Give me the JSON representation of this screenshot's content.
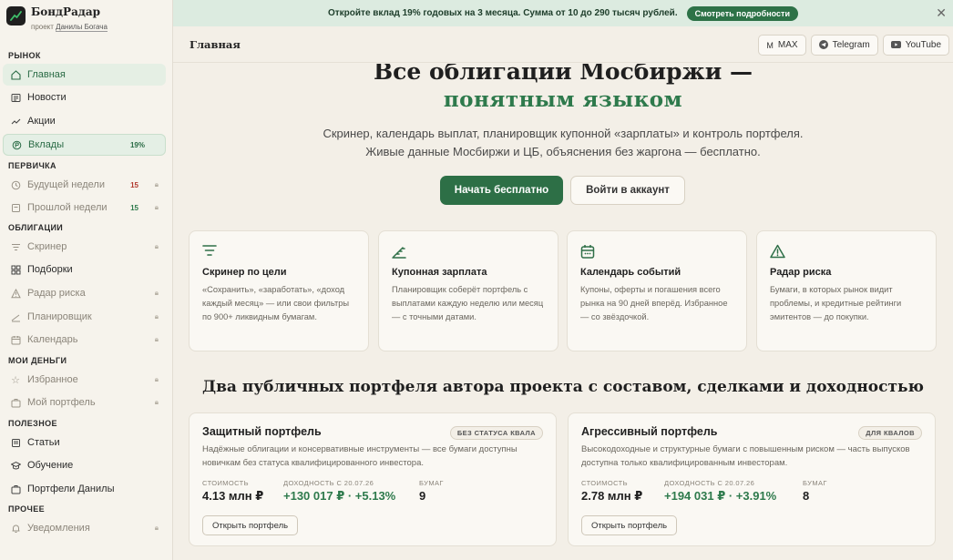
{
  "sidebar": {
    "brand_name": "БондРадар",
    "brand_sub_prefix": "проект",
    "brand_sub_author": "Данилы Богача",
    "sections": {
      "market": "РЫНОК",
      "primary": "ПЕРВИЧКА",
      "bonds": "ОБЛИГАЦИИ",
      "my_money": "МОИ ДЕНЬГИ",
      "useful": "ПОЛЕЗНОЕ",
      "other": "ПРОЧЕЕ"
    },
    "items": {
      "home": "Главная",
      "news": "Новости",
      "stocks": "Акции",
      "deposits": "Вклады",
      "deposits_badge": "19%",
      "next_week": "Будущей недели",
      "next_week_count": "15",
      "past_week": "Прошлой недели",
      "past_week_count": "15",
      "screener": "Скринер",
      "collections": "Подборки",
      "risk_radar": "Радар риска",
      "planner": "Планировщик",
      "calendar": "Календарь",
      "favorites": "Избранное",
      "my_portfolio": "Мой портфель",
      "articles": "Статьи",
      "learning": "Обучение",
      "danila_portfolios": "Портфели Данилы",
      "notifications": "Уведомления"
    }
  },
  "banner": {
    "text": "Откройте вклад 19% годовых на 3 месяца. Сумма от 10 до 290 тысяч рублей.",
    "button": "Смотреть подробности",
    "close": "✕"
  },
  "header": {
    "title": "Главная",
    "links": {
      "max": "MAX",
      "telegram": "Telegram",
      "youtube": "YouTube"
    }
  },
  "hero": {
    "title_line1": "Все облигации Мосбиржи —",
    "title_line2": "понятным языком",
    "lead_line1": "Скринер, календарь выплат, планировщик купонной «зарплаты» и контроль портфеля.",
    "lead_line2": "Живые данные Мосбиржи и ЦБ, объяснения без жаргона — бесплатно.",
    "cta_primary": "Начать бесплатно",
    "cta_secondary": "Войти в аккаунт"
  },
  "features": [
    {
      "title": "Скринер по цели",
      "desc": "«Сохранить», «заработать», «доход каждый месяц» — или свои фильтры по 900+ ликвидным бумагам.",
      "icon": "filter-icon"
    },
    {
      "title": "Купонная зарплата",
      "desc": "Планировщик соберёт портфель с выплатами каждую неделю или месяц — с точными датами.",
      "icon": "stairs-icon"
    },
    {
      "title": "Календарь событий",
      "desc": "Купоны, оферты и погашения всего рынка на 90 дней вперёд. Избранное — со звёздочкой.",
      "icon": "calendar-icon"
    },
    {
      "title": "Радар риска",
      "desc": "Бумаги, в которых рынок видит проблемы, и кредитные рейтинги эмитентов — до покупки.",
      "icon": "warning-icon"
    }
  ],
  "portfolios_heading": "Два публичных портфеля автора проекта с составом, сделками и доходностью",
  "portfolios": [
    {
      "title": "Защитный портфель",
      "tag": "БЕЗ СТАТУСА КВАЛА",
      "desc": "Надёжные облигации и консервативные инструменты — все бумаги доступны новичкам без статуса квалифицированного инвестора.",
      "value_label": "СТОИМОСТЬ",
      "value": "4.13 млн ₽",
      "yield_label": "ДОХОДНОСТЬ С 20.07.26",
      "yield": "+130 017 ₽ · +5.13%",
      "count_label": "БУМАГ",
      "count": "9",
      "button": "Открыть портфель"
    },
    {
      "title": "Агрессивный портфель",
      "tag": "ДЛЯ КВАЛОВ",
      "desc": "Высокодоходные и структурные бумаги с повышенным риском — часть выпусков доступна только квалифицированным инвесторам.",
      "value_label": "СТОИМОСТЬ",
      "value": "2.78 млн ₽",
      "yield_label": "ДОХОДНОСТЬ С 20.07.26",
      "yield": "+194 031 ₽ · +3.91%",
      "count_label": "БУМАГ",
      "count": "8",
      "button": "Открыть портфель"
    }
  ],
  "colors": {
    "accent": "#2d6f46",
    "accent_light": "#dcebe0",
    "background": "#f3efe7",
    "red_count": "#b23a2f"
  }
}
